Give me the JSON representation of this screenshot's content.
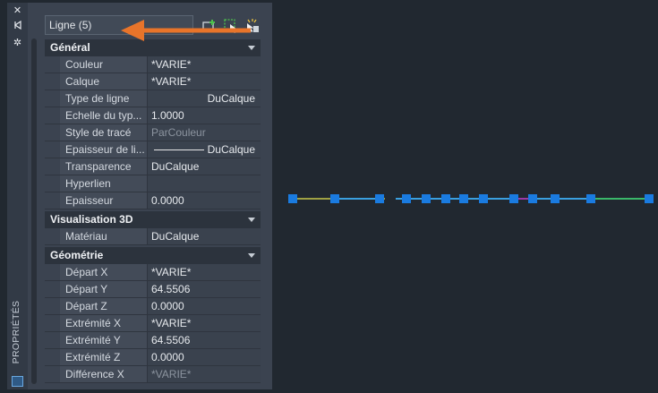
{
  "strip": {
    "label": "PROPRIÉTÉS",
    "icons": [
      "close-icon",
      "auto-hide-icon",
      "settings-icon",
      "palette-icon"
    ]
  },
  "panel": {
    "selection_label": "Ligne (5)",
    "toolbar_icons": [
      "toggle-pickadd-icon",
      "select-objects-icon",
      "quick-select-icon"
    ],
    "sections": [
      {
        "title": "Général",
        "rows": [
          {
            "label": "Couleur",
            "value": "*VARIE*"
          },
          {
            "label": "Calque",
            "value": "*VARIE*"
          },
          {
            "label": "Type de ligne",
            "value": "DuCalque",
            "align": "right"
          },
          {
            "label": "Echelle du typ...",
            "value": "1.0000"
          },
          {
            "label": "Style de tracé",
            "value": "ParCouleur",
            "dim": true
          },
          {
            "label": "Epaisseur de li...",
            "value": "DuCalque",
            "align": "right",
            "line": true
          },
          {
            "label": "Transparence",
            "value": "DuCalque"
          },
          {
            "label": "Hyperlien",
            "value": ""
          },
          {
            "label": "Epaisseur",
            "value": "0.0000"
          }
        ]
      },
      {
        "title": "Visualisation 3D",
        "rows": [
          {
            "label": "Matériau",
            "value": "DuCalque"
          }
        ]
      },
      {
        "title": "Géométrie",
        "rows": [
          {
            "label": "Départ X",
            "value": "*VARIE*"
          },
          {
            "label": "Départ Y",
            "value": "64.5506"
          },
          {
            "label": "Départ Z",
            "value": "0.0000"
          },
          {
            "label": "Extrémité X",
            "value": "*VARIE*"
          },
          {
            "label": "Extrémité Y",
            "value": "64.5506"
          },
          {
            "label": "Extrémité Z",
            "value": "0.0000"
          },
          {
            "label": "Différence X",
            "value": "*VARIE*",
            "dim": true
          }
        ]
      }
    ]
  },
  "colors": {
    "accent_arrow": "#e8742a",
    "grip": "#1a7be0",
    "canvas": "#212830"
  }
}
